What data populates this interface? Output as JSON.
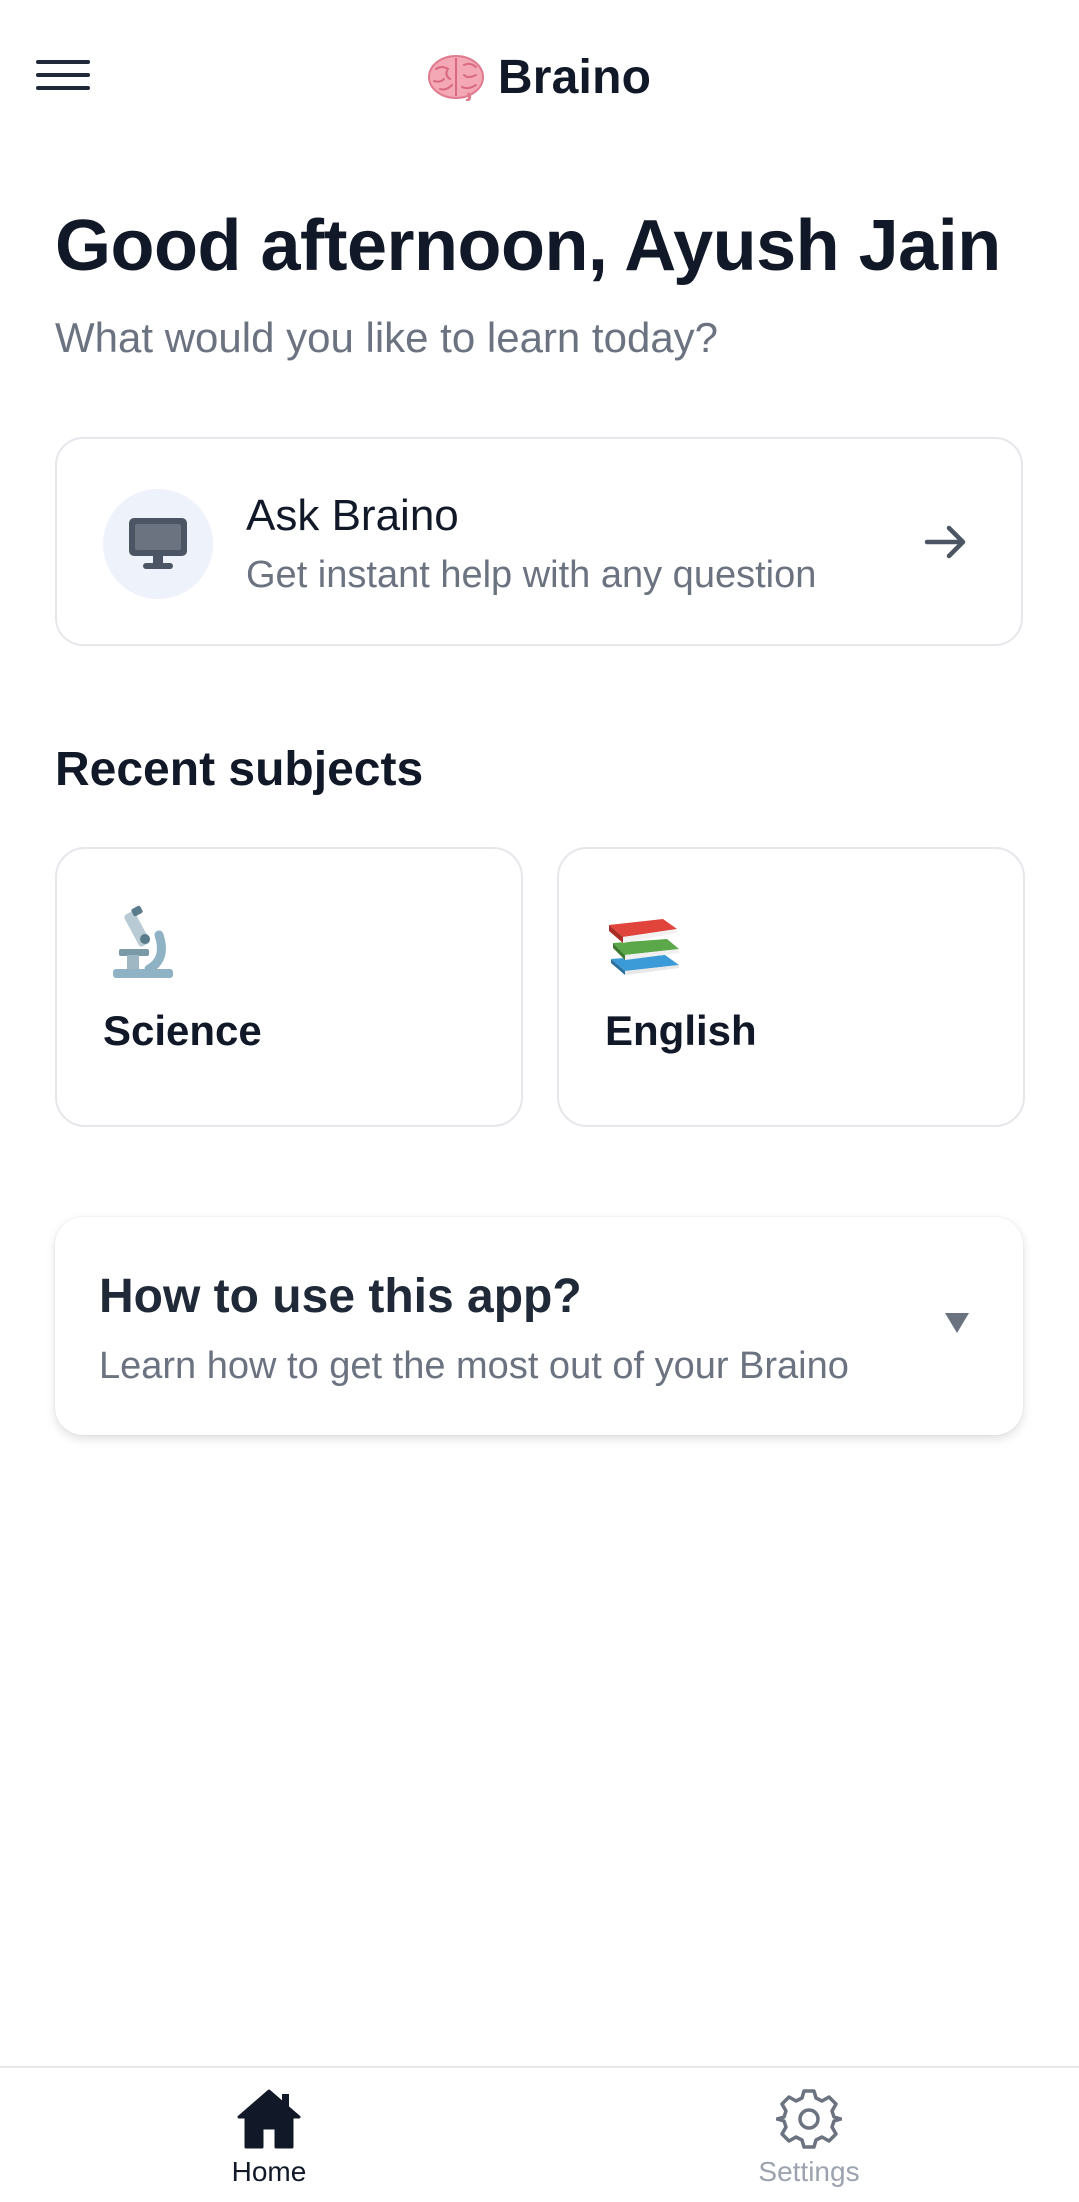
{
  "header": {
    "menu_icon": "hamburger-menu-icon",
    "brand_icon": "brain-icon",
    "brand_name": "Braino"
  },
  "greeting": {
    "title": "Good afternoon, Ayush Jain",
    "subtitle": "What would you like to learn today?"
  },
  "ask_card": {
    "icon": "monitor-icon",
    "title": "Ask Braino",
    "description": "Get instant help with any question",
    "arrow_icon": "arrow-right-icon"
  },
  "recent_subjects": {
    "title": "Recent subjects",
    "items": [
      {
        "label": "Science",
        "icon": "microscope-icon"
      },
      {
        "label": "English",
        "icon": "books-icon"
      }
    ]
  },
  "how_to_use": {
    "title": "How to use this app?",
    "description": "Learn how to get the most out of your Braino",
    "expand_icon": "caret-down-icon",
    "expanded": false
  },
  "bottom_nav": {
    "items": [
      {
        "label": "Home",
        "icon": "home-icon",
        "active": true
      },
      {
        "label": "Settings",
        "icon": "gear-icon",
        "active": false
      }
    ]
  },
  "colors": {
    "primary_text": "#111827",
    "secondary_text": "#6b7280",
    "border": "#e5e7eb",
    "icon_bg": "#eef2fb",
    "inactive_nav": "#9ca3af"
  }
}
